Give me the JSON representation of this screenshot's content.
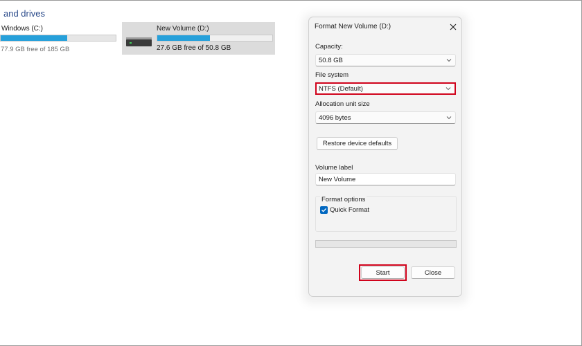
{
  "explorer": {
    "section_title": "and drives",
    "drives": [
      {
        "name": "Windows (C:)",
        "free_text": "77.9 GB free of 185 GB",
        "used_fraction": 0.58
      },
      {
        "name": "New Volume (D:)",
        "free_text": "27.6 GB free of 50.8 GB",
        "used_fraction": 0.46,
        "icon": "hard-drive-icon"
      }
    ]
  },
  "dialog": {
    "title": "Format New Volume (D:)",
    "capacity": {
      "label": "Capacity:",
      "value": "50.8 GB"
    },
    "file_system": {
      "label": "File system",
      "value": "NTFS (Default)"
    },
    "allocation": {
      "label": "Allocation unit size",
      "value": "4096 bytes"
    },
    "restore_button": "Restore device defaults",
    "volume_label": {
      "label": "Volume label",
      "value": "New Volume"
    },
    "format_options": {
      "label": "Format options",
      "quick_format": "Quick Format",
      "quick_format_checked": true
    },
    "progress_fraction": 0,
    "start_button": "Start",
    "close_button": "Close"
  },
  "colors": {
    "accent": "#0067c0",
    "usage_bar": "#26a0da",
    "highlight": "#d0021b",
    "heading": "#2a4a8a"
  }
}
